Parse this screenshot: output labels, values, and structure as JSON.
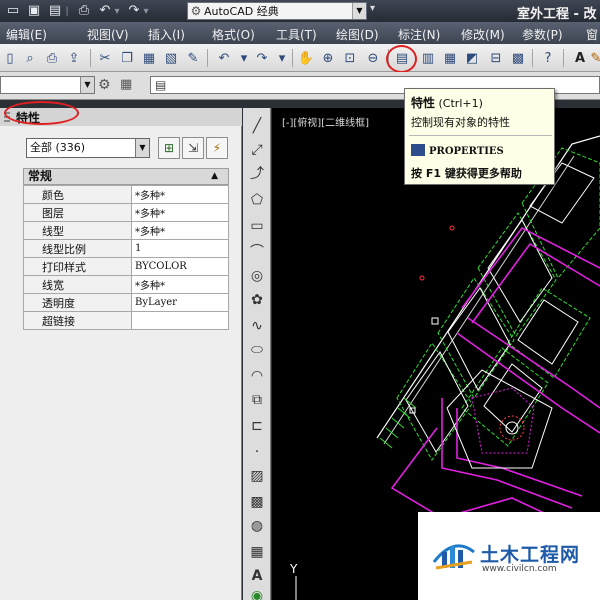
{
  "titlebar": {
    "workspace": "AutoCAD 经典",
    "title": "室外工程 - 改"
  },
  "menu": [
    "编辑(E)",
    "视图(V)",
    "插入(I)",
    "格式(O)",
    "工具(T)",
    "绘图(D)",
    "标注(N)",
    "修改(M)",
    "参数(P)",
    "窗"
  ],
  "properties": {
    "title": "特性",
    "selection": "全部 (336)",
    "section": "常规",
    "rows": [
      {
        "key": "颜色",
        "value": "*多种*"
      },
      {
        "key": "图层",
        "value": "*多种*"
      },
      {
        "key": "线型",
        "value": "*多种*"
      },
      {
        "key": "线型比例",
        "value": "1"
      },
      {
        "key": "打印样式",
        "value": "BYCOLOR"
      },
      {
        "key": "线宽",
        "value": "*多种*"
      },
      {
        "key": "透明度",
        "value": "ByLayer"
      },
      {
        "key": "超链接",
        "value": ""
      }
    ]
  },
  "viewport": {
    "label": "[-][俯视][二维线框]",
    "ucs_axis": "Y"
  },
  "tooltip": {
    "name": "特性",
    "shortcut": "(Ctrl+1)",
    "description": "控制现有对象的特性",
    "command": "PROPERTIES",
    "help": "按 F1 键获得更多帮助"
  },
  "watermark": {
    "name": "土木工程网",
    "url": "www.civilcn.com"
  },
  "colors": {
    "canvas_bg": "#000000",
    "magenta_line": "#e020e0",
    "green_dash": "#2fdc2f",
    "white_line": "#ffffff",
    "highlight_red": "#e02020"
  },
  "icons": {
    "toolbar": [
      "open-icon",
      "save-icon",
      "print-icon",
      "undo-icon",
      "redo-icon",
      "cut-icon",
      "copy-icon",
      "paste-icon",
      "match-properties-icon",
      "pan-icon",
      "zoom-realtime-icon",
      "zoom-window-icon",
      "zoom-previous-icon",
      "properties-icon",
      "design-center-icon",
      "tool-palettes-icon",
      "sheet-set-icon",
      "markup-icon",
      "calculator-icon",
      "help-icon",
      "text-style-icon"
    ],
    "draw": [
      "line-icon",
      "construction-line-icon",
      "polyline-icon",
      "polygon-icon",
      "rectangle-icon",
      "arc-icon",
      "circle-icon",
      "revision-cloud-icon",
      "spline-icon",
      "ellipse-icon",
      "ellipse-arc-icon",
      "insert-block-icon",
      "make-block-icon",
      "point-icon",
      "hatch-icon",
      "gradient-icon",
      "region-icon",
      "table-icon",
      "multiline-text-icon",
      "add-selected-icon"
    ]
  }
}
